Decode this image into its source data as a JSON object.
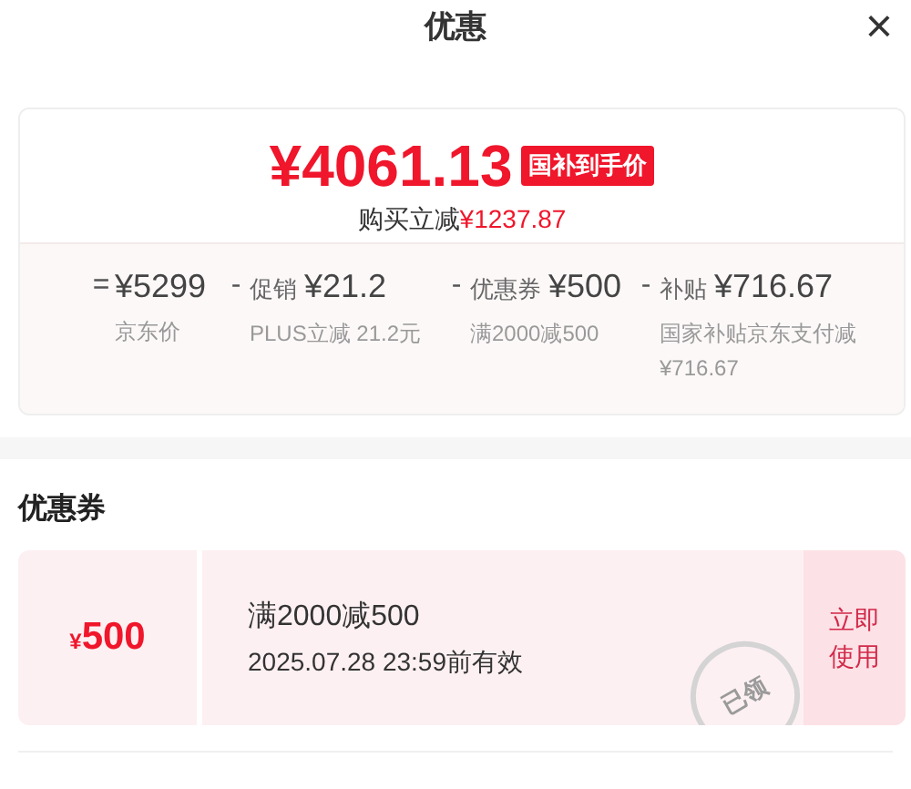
{
  "header": {
    "title": "优惠",
    "close": "×"
  },
  "price": {
    "amount": "¥4061.13",
    "badge": "国补到手价",
    "saving_label": "购买立减",
    "saving_amount": "¥1237.87"
  },
  "breakdown": [
    {
      "op": "=",
      "amount": "¥5299",
      "note": "京东价"
    },
    {
      "op": "-",
      "label": "促销",
      "amount": "¥21.2",
      "note": "PLUS立减 21.2元"
    },
    {
      "op": "-",
      "label": "优惠券",
      "amount": "¥500",
      "note": "满2000减500"
    },
    {
      "op": "-",
      "label": "补贴",
      "amount": "¥716.67",
      "note": "国家补贴京东支付减¥716.67"
    }
  ],
  "coupon_section": {
    "title": "优惠券",
    "coupons": [
      {
        "currency": "¥",
        "value": "500",
        "condition": "满2000减500",
        "validity": "2025.07.28 23:59前有效",
        "stamp": "已领",
        "action": "立即使用"
      }
    ]
  }
}
